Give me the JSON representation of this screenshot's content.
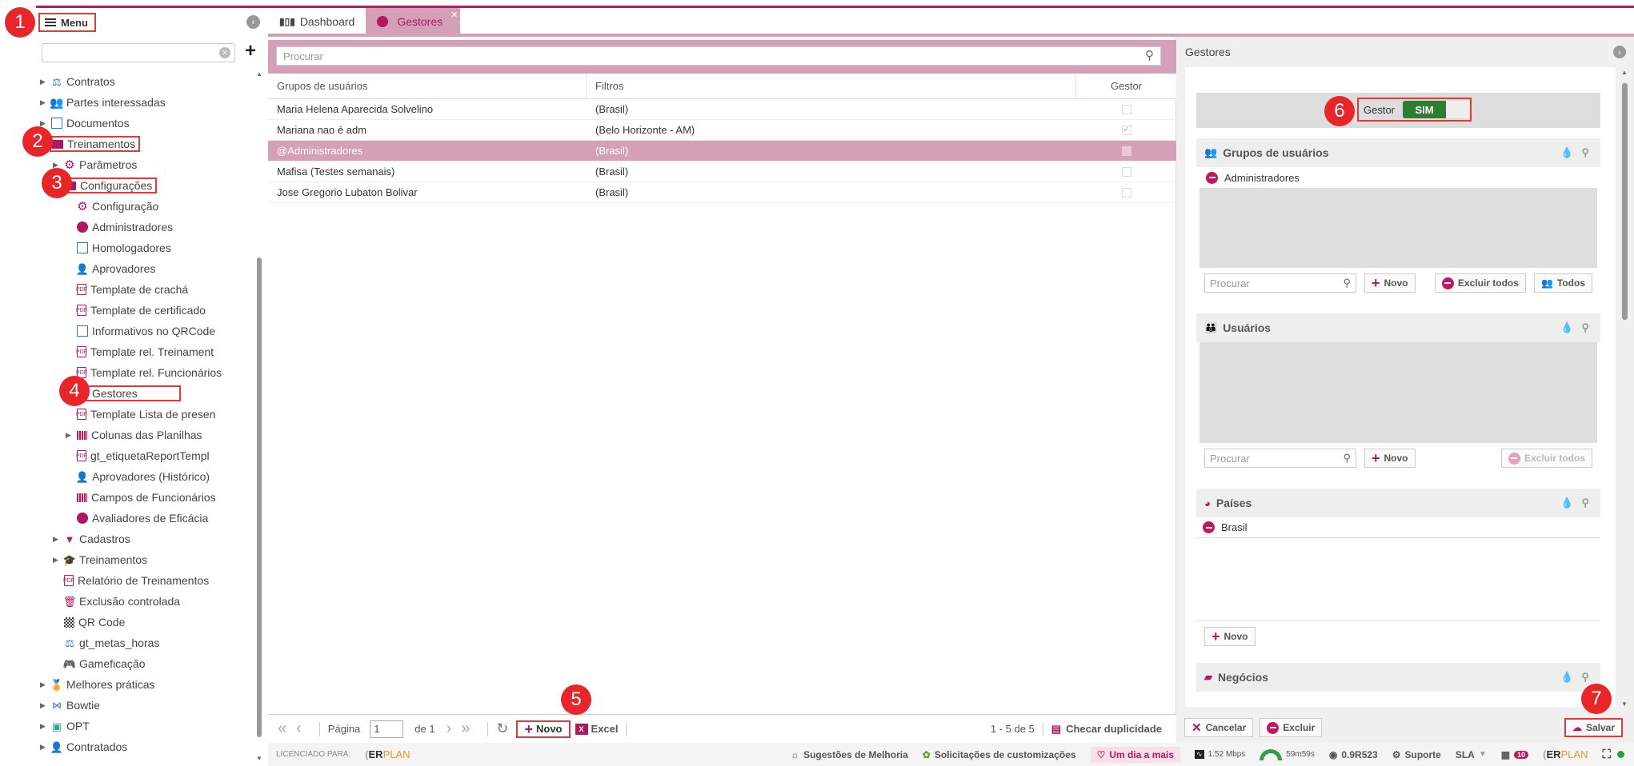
{
  "sidebar": {
    "menu_label": "Menu",
    "search_value": "",
    "items": [
      {
        "label": "Contratos",
        "icon": "scale-icon",
        "level": 0,
        "caret": true
      },
      {
        "label": "Partes interessadas",
        "icon": "people-icon",
        "level": 0,
        "caret": true
      },
      {
        "label": "Documentos",
        "icon": "document-icon",
        "level": 0,
        "caret": true
      },
      {
        "label": "Treinamentos",
        "icon": "folder-open-icon",
        "level": 0,
        "caret": false,
        "expanded": true,
        "marked": true
      },
      {
        "label": "Parâmetros",
        "icon": "gear-icon",
        "level": 1,
        "caret": true
      },
      {
        "label": "Configurações",
        "icon": "folder-open-icon",
        "level": 1,
        "caret": false,
        "expanded": true,
        "marked": true
      },
      {
        "label": "Configuração",
        "icon": "gear-icon",
        "level": 2,
        "caret": false
      },
      {
        "label": "Administradores",
        "icon": "user-circle-icon",
        "level": 2,
        "caret": false
      },
      {
        "label": "Homologadores",
        "icon": "document-icon",
        "level": 2,
        "caret": false
      },
      {
        "label": "Aprovadores",
        "icon": "person-icon",
        "level": 2,
        "caret": false
      },
      {
        "label": "Template de crachá",
        "icon": "pdf-icon",
        "level": 2,
        "caret": false
      },
      {
        "label": "Template de certificado",
        "icon": "pdf-icon",
        "level": 2,
        "caret": false
      },
      {
        "label": "Informativos no QRCode",
        "icon": "document-icon",
        "level": 2,
        "caret": false
      },
      {
        "label": "Template rel. Treinament",
        "icon": "pdf-icon",
        "level": 2,
        "caret": false
      },
      {
        "label": "Template rel. Funcionários",
        "icon": "pdf-icon",
        "level": 2,
        "caret": false
      },
      {
        "label": "Gestores",
        "icon": "user-circle-icon",
        "level": 2,
        "caret": false,
        "marked": true
      },
      {
        "label": "Template Lista de presen",
        "icon": "pdf-icon",
        "level": 2,
        "caret": false
      },
      {
        "label": "Colunas das Planilhas",
        "icon": "grid-icon",
        "level": 2,
        "caret": true
      },
      {
        "label": "gt_etiquetaReportTempl",
        "icon": "pdf-icon",
        "level": 2,
        "caret": false
      },
      {
        "label": "Aprovadores (Histórico)",
        "icon": "person-icon",
        "level": 2,
        "caret": false
      },
      {
        "label": "Campos de Funcionários",
        "icon": "grid-icon",
        "level": 2,
        "caret": false
      },
      {
        "label": "Avaliadores de Eficácia",
        "icon": "user-circle-icon",
        "level": 2,
        "caret": false
      },
      {
        "label": "Cadastros",
        "icon": "chat-icon",
        "level": 1,
        "caret": true
      },
      {
        "label": "Treinamentos",
        "icon": "graduation-cap-icon",
        "level": 1,
        "caret": true
      },
      {
        "label": "Relatório de Treinamentos",
        "icon": "pdf-icon",
        "level": 1,
        "caret": false
      },
      {
        "label": "Exclusão controlada",
        "icon": "trash-icon",
        "level": 1,
        "caret": false
      },
      {
        "label": "QR Code",
        "icon": "qr-code-icon",
        "level": 1,
        "caret": false
      },
      {
        "label": "gt_metas_horas",
        "icon": "scale-icon",
        "level": 1,
        "caret": false
      },
      {
        "label": "Gameficação",
        "icon": "gamepad-icon",
        "level": 1,
        "caret": false
      },
      {
        "label": "Melhores práticas",
        "icon": "award-icon",
        "level": 0,
        "caret": true
      },
      {
        "label": "Bowtie",
        "icon": "bowtie-icon",
        "level": 0,
        "caret": true
      },
      {
        "label": "OPT",
        "icon": "opt-icon",
        "level": 0,
        "caret": true
      },
      {
        "label": "Contratados",
        "icon": "contractor-icon",
        "level": 0,
        "caret": true
      }
    ]
  },
  "tabs": [
    {
      "label": "Dashboard",
      "icon": "bar-chart-icon"
    },
    {
      "label": "Gestores",
      "icon": "user-circle-icon",
      "active": true
    }
  ],
  "list": {
    "search_placeholder": "Procurar",
    "columns": [
      "Grupos de usuários",
      "Filtros",
      "Gestor"
    ],
    "rows": [
      {
        "grupo": "Maria Helena Aparecida Solvelino",
        "filtro": "(Brasil)",
        "gestor": false,
        "selected": false
      },
      {
        "grupo": "Mariana nao é adm",
        "filtro": "(Belo Horizonte - AM)",
        "gestor": true,
        "selected": false
      },
      {
        "grupo": "@Administradores",
        "filtro": "(Brasil)",
        "gestor": false,
        "selected": true
      },
      {
        "grupo": "Mafisa (Testes semanais)",
        "filtro": "(Brasil)",
        "gestor": false,
        "selected": false
      },
      {
        "grupo": "Jose Gregorio Lubaton Bolivar",
        "filtro": "(Brasil)",
        "gestor": false,
        "selected": false
      }
    ],
    "footer": {
      "page_label": "Página",
      "page_value": "1",
      "page_of": "de 1",
      "novo_label": "Novo",
      "excel_label": "Excel",
      "range": "1 - 5 de 5",
      "check_dup_label": "Checar duplicidade"
    }
  },
  "panel": {
    "title": "Gestores",
    "gestor_label": "Gestor",
    "gestor_toggle": "SIM",
    "grupos": {
      "title": "Grupos de usuários",
      "items": [
        "Administradores"
      ],
      "search_placeholder": "Procurar",
      "novo": "Novo",
      "excluir_todos": "Excluir todos",
      "todos": "Todos"
    },
    "usuarios": {
      "title": "Usuários",
      "search_placeholder": "Procurar",
      "novo": "Novo",
      "excluir_todos": "Excluir todos"
    },
    "paises": {
      "title": "Países",
      "items": [
        "Brasil"
      ],
      "novo": "Novo"
    },
    "negocios": {
      "title": "Negócios"
    },
    "footer": {
      "cancelar": "Cancelar",
      "excluir": "Excluir",
      "salvar": "Salvar"
    }
  },
  "statusbar": {
    "licensed_label": "LICENCIADO PARA:",
    "brand_er": "ER",
    "brand_plan": "PLAN",
    "sugestoes": "Sugestões de Melhoria",
    "solicitacoes": "Solicitações de customizações",
    "um_dia": "Um dia a mais",
    "speed": "1.52 Mbps",
    "time": "59m59s",
    "version": "0.9R523",
    "suporte": "Suporte",
    "sla": "SLA",
    "badge": "10"
  },
  "markers": [
    "1",
    "2",
    "3",
    "4",
    "5",
    "6",
    "7"
  ],
  "colors": {
    "accent": "#b01e6a",
    "tab_active_bg": "#d3a0b8",
    "toggle_on": "#2e7d32",
    "marker_red": "#e8262a"
  }
}
